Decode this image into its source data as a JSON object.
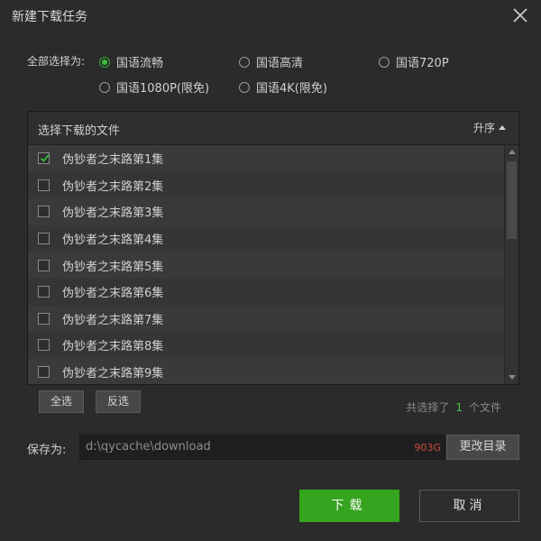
{
  "window": {
    "title": "新建下载任务"
  },
  "quality": {
    "label": "全部选择为:",
    "options": [
      {
        "label": "国语流畅",
        "checked": true
      },
      {
        "label": "国语高清",
        "checked": false
      },
      {
        "label": "国语720P",
        "checked": false
      },
      {
        "label": "国语1080P(限免)",
        "checked": false
      },
      {
        "label": "国语4K(限免)",
        "checked": false
      }
    ]
  },
  "files": {
    "header": "选择下载的文件",
    "sort_label": "升序",
    "items": [
      {
        "name": "伪钞者之末路第1集",
        "checked": true
      },
      {
        "name": "伪钞者之末路第2集",
        "checked": false
      },
      {
        "name": "伪钞者之末路第3集",
        "checked": false
      },
      {
        "name": "伪钞者之末路第4集",
        "checked": false
      },
      {
        "name": "伪钞者之末路第5集",
        "checked": false
      },
      {
        "name": "伪钞者之末路第6集",
        "checked": false
      },
      {
        "name": "伪钞者之末路第7集",
        "checked": false
      },
      {
        "name": "伪钞者之末路第8集",
        "checked": false
      },
      {
        "name": "伪钞者之末路第9集",
        "checked": false
      }
    ],
    "select_all": "全选",
    "invert": "反选",
    "count_prefix": "共选择了",
    "count": "1",
    "count_suffix": "个文件"
  },
  "save": {
    "label": "保存为:",
    "path": "d:\\qycache\\download",
    "free_space": "903G",
    "change_dir": "更改目录"
  },
  "actions": {
    "download": "下载",
    "cancel": "取消"
  },
  "colors": {
    "accent": "#35a41e",
    "background": "#2b2b2b",
    "size_warning": "#d24a3a"
  }
}
